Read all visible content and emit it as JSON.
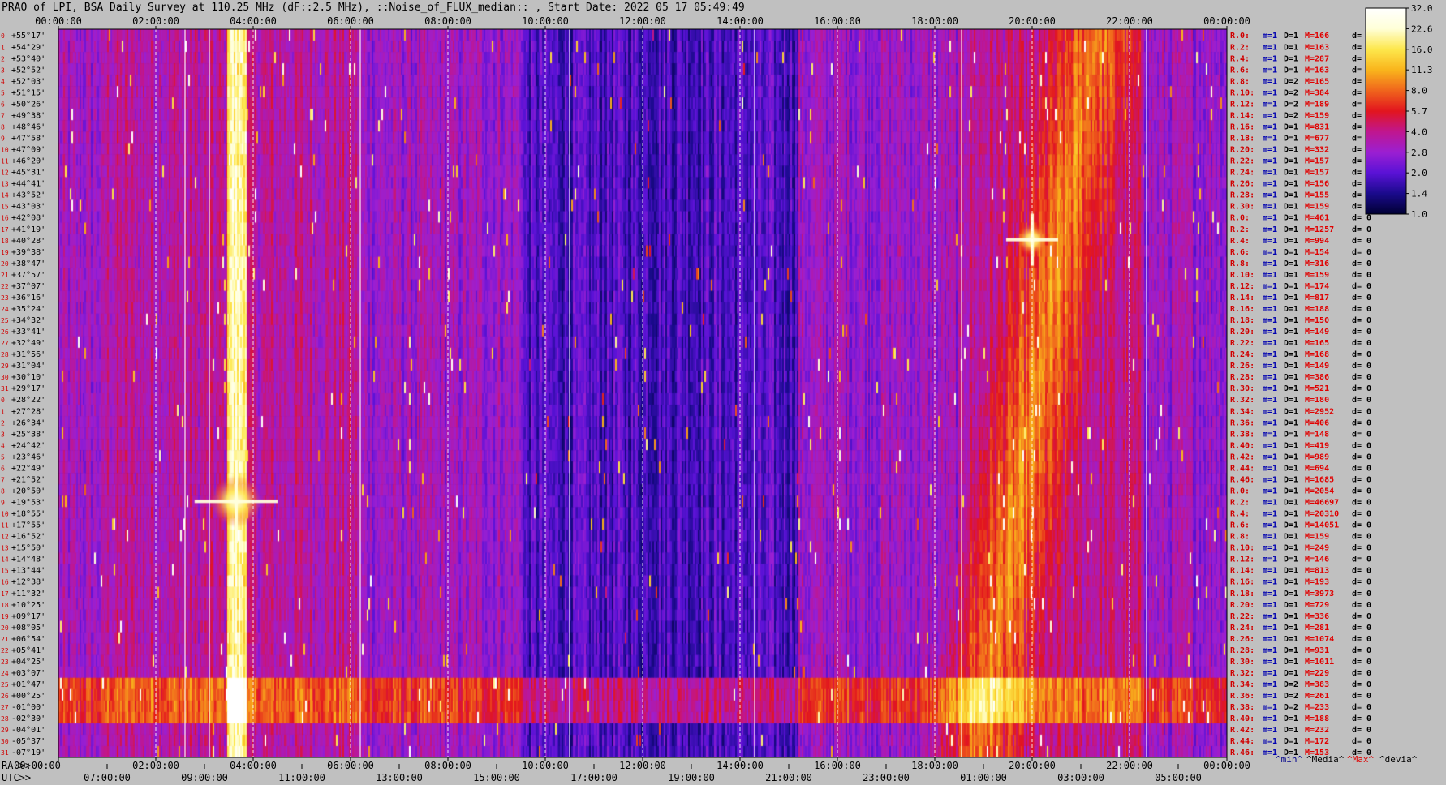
{
  "title": "PRAO of LPI, BSA Daily Survey at 110.25 MHz (dF::2.5 MHz), ::Noise_of_FLUX_median:: , Start Date: 2022 05 17 05:49:49",
  "colors": {
    "background": "#c0c0c0",
    "index_text": "#d00000",
    "m_text": "#0000b0",
    "max_text": "#e00000"
  },
  "chart_data": {
    "type": "heatmap",
    "title": "PRAO of LPI, BSA Daily Survey at 110.25 MHz (dF::2.5 MHz), ::Noise_of_FLUX_median:: , Start Date: 2022 05 17 05:49:49",
    "utc_ticks_top": [
      "00:00:00",
      "02:00:00",
      "04:00:00",
      "06:00:00",
      "08:00:00",
      "10:00:00",
      "12:00:00",
      "14:00:00",
      "16:00:00",
      "18:00:00",
      "20:00:00",
      "22:00:00",
      "00:00:00"
    ],
    "ra_label": "RA >>",
    "ra_ticks": [
      "00:00:00",
      "02:00:00",
      "04:00:00",
      "06:00:00",
      "08:00:00",
      "10:00:00",
      "12:00:00",
      "14:00:00",
      "16:00:00",
      "18:00:00",
      "20:00:00",
      "22:00:00",
      "00:00:00"
    ],
    "utc_label": "UTC>>",
    "utc_ticks_bottom": [
      "07:00:00",
      "09:00:00",
      "11:00:00",
      "13:00:00",
      "15:00:00",
      "17:00:00",
      "19:00:00",
      "21:00:00",
      "23:00:00",
      "01:00:00",
      "03:00:00",
      "05:00:00"
    ],
    "declinations": [
      "+55°17'",
      "+54°29'",
      "+53°40'",
      "+52°52'",
      "+52°03'",
      "+51°15'",
      "+50°26'",
      "+49°38'",
      "+48°46'",
      "+47°58'",
      "+47°09'",
      "+46°20'",
      "+45°31'",
      "+44°41'",
      "+43°52'",
      "+43°03'",
      "+42°08'",
      "+41°19'",
      "+40°28'",
      "+39°38'",
      "+38°47'",
      "+37°57'",
      "+37°07'",
      "+36°16'",
      "+35°24'",
      "+34°32'",
      "+33°41'",
      "+32°49'",
      "+31°56'",
      "+31°04'",
      "+30°10'",
      "+29°17'",
      "+28°22'",
      "+27°28'",
      "+26°34'",
      "+25°38'",
      "+24°42'",
      "+23°46'",
      "+22°49'",
      "+21°52'",
      "+20°50'",
      "+19°53'",
      "+18°55'",
      "+17°55'",
      "+16°52'",
      "+15°50'",
      "+14°48'",
      "+13°44'",
      "+12°38'",
      "+11°32'",
      "+10°25'",
      "+09°17'",
      "+08°05'",
      "+06°54'",
      "+05°41'",
      "+04°25'",
      "+03°07'",
      "+01°47'",
      "+00°25'",
      "-01°00'",
      "-02°30'",
      "-04°01'",
      "-05°37'",
      "-07°19'"
    ],
    "row_indices": [
      "0",
      "1",
      "2",
      "3",
      "4",
      "5",
      "6",
      "7",
      "8",
      "9",
      "10",
      "11",
      "12",
      "13",
      "14",
      "15",
      "16",
      "17",
      "18",
      "19",
      "20",
      "21",
      "22",
      "23",
      "24",
      "25",
      "26",
      "27",
      "28",
      "29",
      "30",
      "31",
      "0",
      "1",
      "2",
      "3",
      "4",
      "5",
      "6",
      "7",
      "8",
      "9",
      "10",
      "11",
      "12",
      "13",
      "14",
      "15",
      "16",
      "17",
      "18",
      "19",
      "20",
      "21",
      "22",
      "23",
      "24",
      "25",
      "26",
      "27",
      "28",
      "29",
      "30",
      "31"
    ],
    "colorbar": {
      "ticks": [
        "32.0",
        "22.6",
        "16.0",
        "11.3",
        "8.0",
        "5.7",
        "4.0",
        "2.8",
        "2.0",
        "1.4",
        "1.0"
      ],
      "range": [
        1.0,
        32.0
      ],
      "scale": "log",
      "colors": [
        "#000033",
        "#1a0a8c",
        "#5a12d6",
        "#9b1fd2",
        "#c0168f",
        "#e2151e",
        "#f0651c",
        "#f9b51c",
        "#fde74c",
        "#ffffd8",
        "#ffffff"
      ]
    },
    "side_table": {
      "row_labels": [
        "R.0:",
        "R.2:",
        "R.4:",
        "R.6:",
        "R.8:",
        "R.10:",
        "R.12:",
        "R.14:",
        "R.16:",
        "R.18:",
        "R.20:",
        "R.22:",
        "R.24:",
        "R.26:",
        "R.28:",
        "R.30:",
        "R.0:",
        "R.2:",
        "R.4:",
        "R.6:",
        "R.8:",
        "R.10:",
        "R.12:",
        "R.14:",
        "R.16:",
        "R.18:",
        "R.20:",
        "R.22:",
        "R.24:",
        "R.26:",
        "R.28:",
        "R.30:",
        "R.32:",
        "R.34:",
        "R.36:",
        "R.38:",
        "R.40:",
        "R.42:",
        "R.44:",
        "R.46:",
        "R.0:",
        "R.2:",
        "R.4:",
        "R.6:",
        "R.8:",
        "R.10:",
        "R.12:",
        "R.14:",
        "R.16:",
        "R.18:",
        "R.20:",
        "R.22:",
        "R.24:",
        "R.26:",
        "R.28:",
        "R.30:",
        "R.32:",
        "R.34:",
        "R.36:",
        "R.38:",
        "R.40:",
        "R.42:",
        "R.44:",
        "R.46:"
      ],
      "m": [
        "m=1",
        "m=1",
        "m=1",
        "m=1",
        "m=1",
        "m=1",
        "m=1",
        "m=1",
        "m=1",
        "m=1",
        "m=1",
        "m=1",
        "m=1",
        "m=1",
        "m=1",
        "m=1",
        "m=1",
        "m=1",
        "m=1",
        "m=1",
        "m=1",
        "m=1",
        "m=1",
        "m=1",
        "m=1",
        "m=1",
        "m=1",
        "m=1",
        "m=1",
        "m=1",
        "m=1",
        "m=1",
        "m=1",
        "m=1",
        "m=1",
        "m=1",
        "m=1",
        "m=1",
        "m=1",
        "m=1",
        "m=1",
        "m=1",
        "m=1",
        "m=1",
        "m=1",
        "m=1",
        "m=1",
        "m=1",
        "m=1",
        "m=1",
        "m=1",
        "m=1",
        "m=1",
        "m=1",
        "m=1",
        "m=1",
        "m=1",
        "m=1",
        "m=1",
        "m=1",
        "m=1",
        "m=1",
        "m=1",
        "m=1"
      ],
      "D": [
        "D=1",
        "D=1",
        "D=1",
        "D=1",
        "D=2",
        "D=2",
        "D=2",
        "D=2",
        "D=1",
        "D=1",
        "D=1",
        "D=1",
        "D=1",
        "D=1",
        "D=1",
        "D=1",
        "D=1",
        "D=1",
        "D=1",
        "D=1",
        "D=1",
        "D=1",
        "D=1",
        "D=1",
        "D=1",
        "D=1",
        "D=1",
        "D=1",
        "D=1",
        "D=1",
        "D=1",
        "D=1",
        "D=1",
        "D=1",
        "D=1",
        "D=1",
        "D=1",
        "D=1",
        "D=1",
        "D=1",
        "D=1",
        "D=1",
        "D=1",
        "D=1",
        "D=1",
        "D=1",
        "D=1",
        "D=1",
        "D=1",
        "D=1",
        "D=1",
        "D=1",
        "D=1",
        "D=1",
        "D=1",
        "D=1",
        "D=1",
        "D=2",
        "D=2",
        "D=2",
        "D=1",
        "D=1",
        "D=1",
        "D=1"
      ],
      "M": [
        "M=166",
        "M=163",
        "M=287",
        "M=163",
        "M=165",
        "M=384",
        "M=189",
        "M=159",
        "M=831",
        "M=677",
        "M=332",
        "M=157",
        "M=157",
        "M=156",
        "M=155",
        "M=159",
        "M=461",
        "M=1257",
        "M=994",
        "M=154",
        "M=316",
        "M=159",
        "M=174",
        "M=817",
        "M=188",
        "M=150",
        "M=149",
        "M=165",
        "M=168",
        "M=149",
        "M=386",
        "M=521",
        "M=180",
        "M=2952",
        "M=406",
        "M=148",
        "M=419",
        "M=989",
        "M=694",
        "M=1685",
        "M=2054",
        "M=46697",
        "M=20310",
        "M=14051",
        "M=159",
        "M=249",
        "M=146",
        "M=813",
        "M=193",
        "M=3973",
        "M=729",
        "M=336",
        "M=281",
        "M=1074",
        "M=931",
        "M=1011",
        "M=229",
        "M=383",
        "M=261",
        "M=233",
        "M=188",
        "M=232",
        "M=172",
        "M=153"
      ],
      "d": [
        "d= 0",
        "d= 0",
        "d= 0",
        "d= 0",
        "d= 0",
        "d=",
        "d=",
        "d=",
        "d= 0",
        "d= 0",
        "d= 0",
        "d= 0",
        "d= 0",
        "d= 0",
        "d= 0",
        "d= 0",
        "d= 0",
        "d= 0",
        "d= 0",
        "d= 0",
        "d= 0",
        "d= 0",
        "d= 0",
        "d= 0",
        "d= 0",
        "d= 0",
        "d= 0",
        "d= 0",
        "d= 0",
        "d= 0",
        "d= 0",
        "d= 0",
        "d= 0",
        "d= 0",
        "d= 0",
        "d= 0",
        "d= 0",
        "d= 0",
        "d= 0",
        "d= 0",
        "d= 0",
        "d= 0",
        "d= 0",
        "d= 0",
        "d= 0",
        "d= 0",
        "d= 0",
        "d= 0",
        "d= 0",
        "d= 0",
        "d= 0",
        "d= 0",
        "d= 0",
        "d= 0",
        "d= 0",
        "d= 0",
        "d= 0",
        "d= 0",
        "d= 0",
        "d= 0",
        "d= 0",
        "d= 0",
        "d= 0",
        "d= 0"
      ]
    },
    "legend": {
      "min": "^min^",
      "median": "^Media^",
      "max": "^Max^",
      "dev": "^devia^"
    },
    "features": {
      "bright_vertical_band_utc_hours": [
        3.45,
        3.85
      ],
      "bright_source_1": {
        "utc": 3.65,
        "dec_index": 41
      },
      "bright_source_2": {
        "utc": 20.0,
        "dec_index": 18
      },
      "bright_band_dec_indices": [
        57,
        60
      ],
      "dashed_time_lines_utc": [
        2.0,
        4.0,
        6.0,
        8.0,
        10.0,
        12.0,
        14.0,
        16.0,
        18.0,
        20.0,
        22.0
      ],
      "solid_bright_lines_utc": [
        2.6,
        3.1,
        6.2,
        10.5,
        14.3,
        18.55,
        22.35
      ]
    }
  }
}
